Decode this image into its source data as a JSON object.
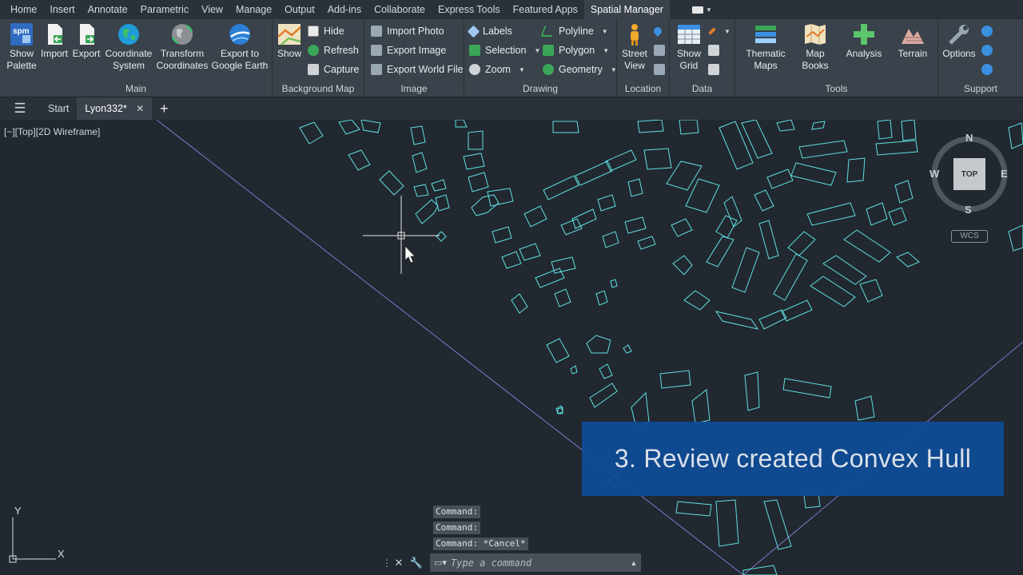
{
  "menu": {
    "tabs": [
      "Home",
      "Insert",
      "Annotate",
      "Parametric",
      "View",
      "Manage",
      "Output",
      "Add-ins",
      "Collaborate",
      "Express Tools",
      "Featured Apps",
      "Spatial Manager"
    ],
    "active": "Spatial Manager"
  },
  "ribbon": {
    "main": {
      "label": "Main",
      "show_palette": "Show\nPalette",
      "import": "Import",
      "export": "Export",
      "coordinate_system": "Coordinate\nSystem",
      "transform_coordinates": "Transform\nCoordinates",
      "export_google_earth": "Export to\nGoogle Earth"
    },
    "background_map": {
      "label": "Background Map",
      "show": "Show",
      "hide": "Hide",
      "refresh": "Refresh",
      "capture": "Capture"
    },
    "image": {
      "label": "Image",
      "import_photo": "Import Photo",
      "export_image": "Export Image",
      "export_world_file": "Export World File"
    },
    "drawing": {
      "label": "Drawing",
      "labels": "Labels",
      "selection": "Selection",
      "zoom": "Zoom",
      "polyline": "Polyline",
      "polygon": "Polygon",
      "geometry": "Geometry"
    },
    "location": {
      "label": "Location",
      "street_view": "Street\nView"
    },
    "data": {
      "label": "Data",
      "show_grid": "Show\nGrid"
    },
    "tools": {
      "label": "Tools",
      "thematic_maps": "Thematic\nMaps",
      "map_books": "Map\nBooks",
      "analysis": "Analysis",
      "terrain": "Terrain"
    },
    "support": {
      "label": "Support",
      "options": "Options"
    }
  },
  "filetabs": {
    "start": "Start",
    "active": "Lyon332*"
  },
  "viewport": {
    "label": "[−][Top][2D Wireframe]"
  },
  "navcube": {
    "north": "N",
    "south": "S",
    "east": "E",
    "west": "W",
    "top": "TOP",
    "wcs": "WCS"
  },
  "ucs": {
    "x": "X",
    "y": "Y"
  },
  "overlay": {
    "text": "3. Review created Convex Hull"
  },
  "command": {
    "history": [
      "Command:",
      "Command:",
      "Command: *Cancel*"
    ],
    "placeholder": "Type a command"
  },
  "colors": {
    "background": "#212830",
    "ribbon": "#3a424b",
    "buildings": "#5fe0e0",
    "hull_line": "#8b7fd6",
    "overlay": "#0e4c97"
  }
}
